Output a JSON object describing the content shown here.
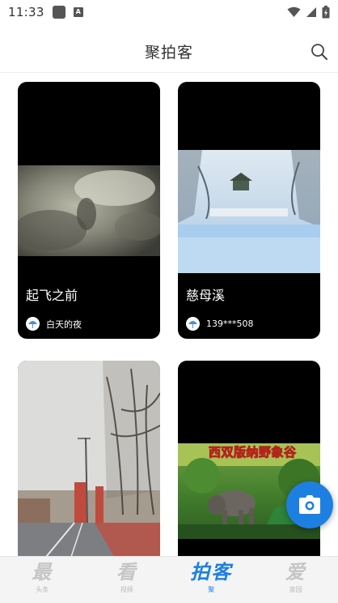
{
  "status_bar": {
    "time": "11:33",
    "notif_letter": "A"
  },
  "header": {
    "title": "聚拍客"
  },
  "feed": {
    "cards": [
      {
        "title": "起飞之前",
        "author": "白天的夜"
      },
      {
        "title": "慈母溪",
        "author": "139***508"
      },
      {
        "title": "",
        "author": ""
      },
      {
        "title": "",
        "author": "",
        "overlay_text": "西双版纳野象谷"
      }
    ]
  },
  "bottom_nav": {
    "items": [
      {
        "glyph": "最",
        "sub": "头条"
      },
      {
        "glyph": "看",
        "sub": "视频"
      },
      {
        "glyph": "拍客",
        "sub": "聚"
      },
      {
        "glyph": "爱",
        "sub": "家园"
      }
    ],
    "active_index": 2
  },
  "colors": {
    "accent": "#1e7fe3",
    "card_bg": "#000000",
    "nav_inactive": "#c6c6c6"
  },
  "icons": [
    "wifi-icon",
    "signal-icon",
    "battery-icon",
    "search-icon",
    "camera-icon"
  ]
}
